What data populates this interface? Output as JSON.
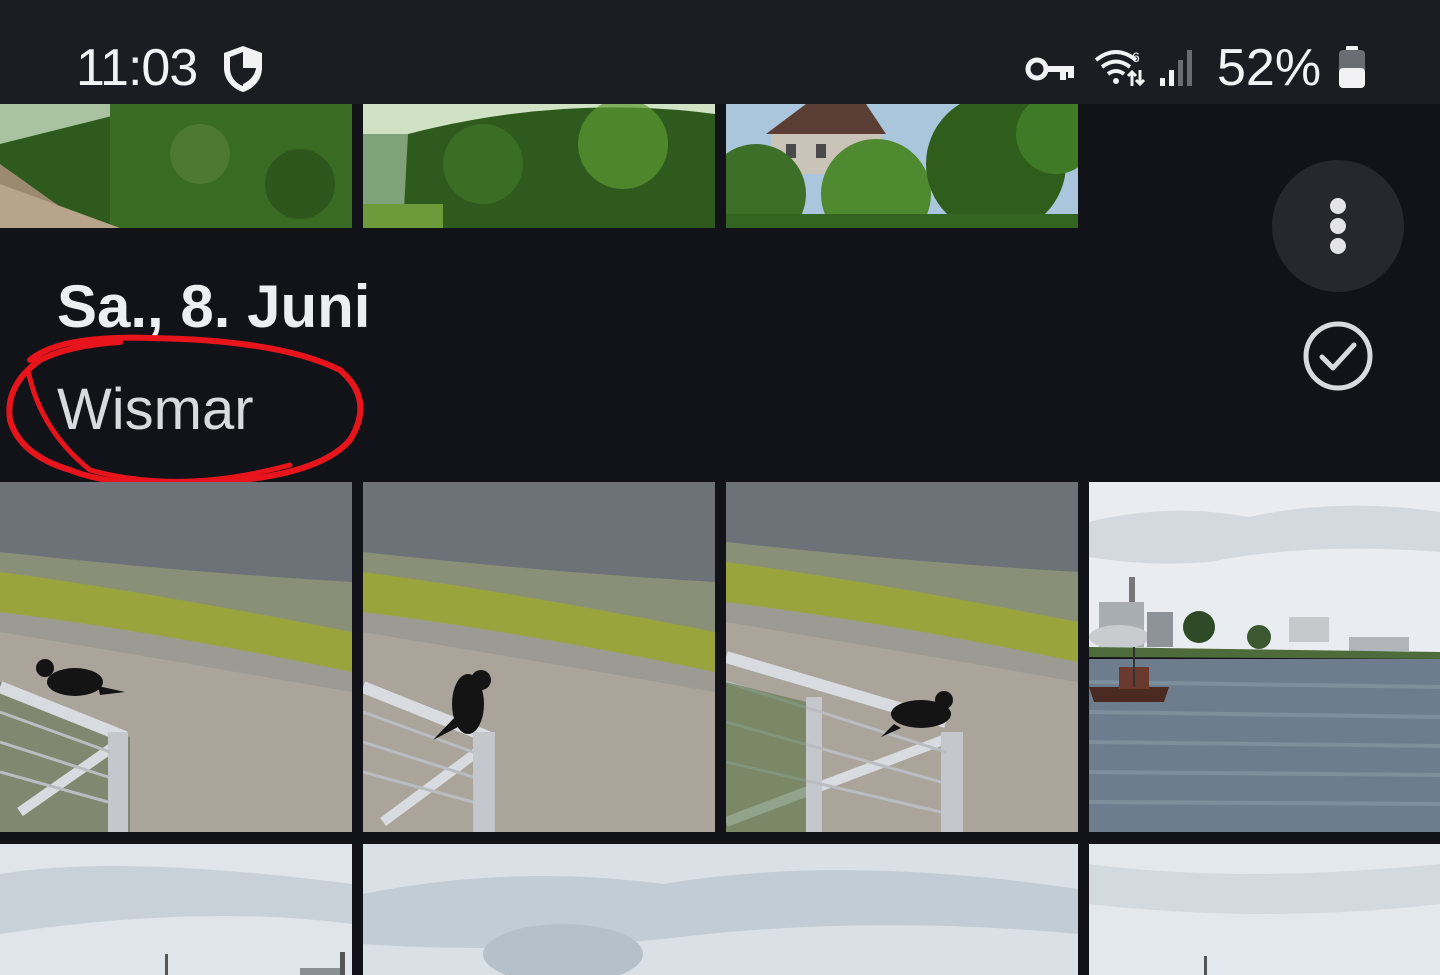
{
  "status_bar": {
    "time": "11:03",
    "battery_percent": "52%",
    "battery_level": 0.52,
    "icons": [
      "shield-icon",
      "vpn-key-icon",
      "wifi-6-icon",
      "signal-icon",
      "battery-icon"
    ]
  },
  "section": {
    "date": "Sa., 8. Juni",
    "location": "Wismar"
  },
  "actions": {
    "menu_icon": "more-vert-icon",
    "select_icon": "check-circle-icon"
  },
  "photos": {
    "top_row": [
      "hedge path",
      "hedge",
      "garden house"
    ],
    "main_row": [
      "crow on railing",
      "crow on railing",
      "crow on railing",
      "harbor with ship"
    ],
    "bottom_row": [
      "harbor sky",
      "harbor sky wide",
      "harbor sky"
    ]
  },
  "colors": {
    "background": "#121318",
    "status_bar": "#1b1d23",
    "annotation": "#e8141c"
  }
}
